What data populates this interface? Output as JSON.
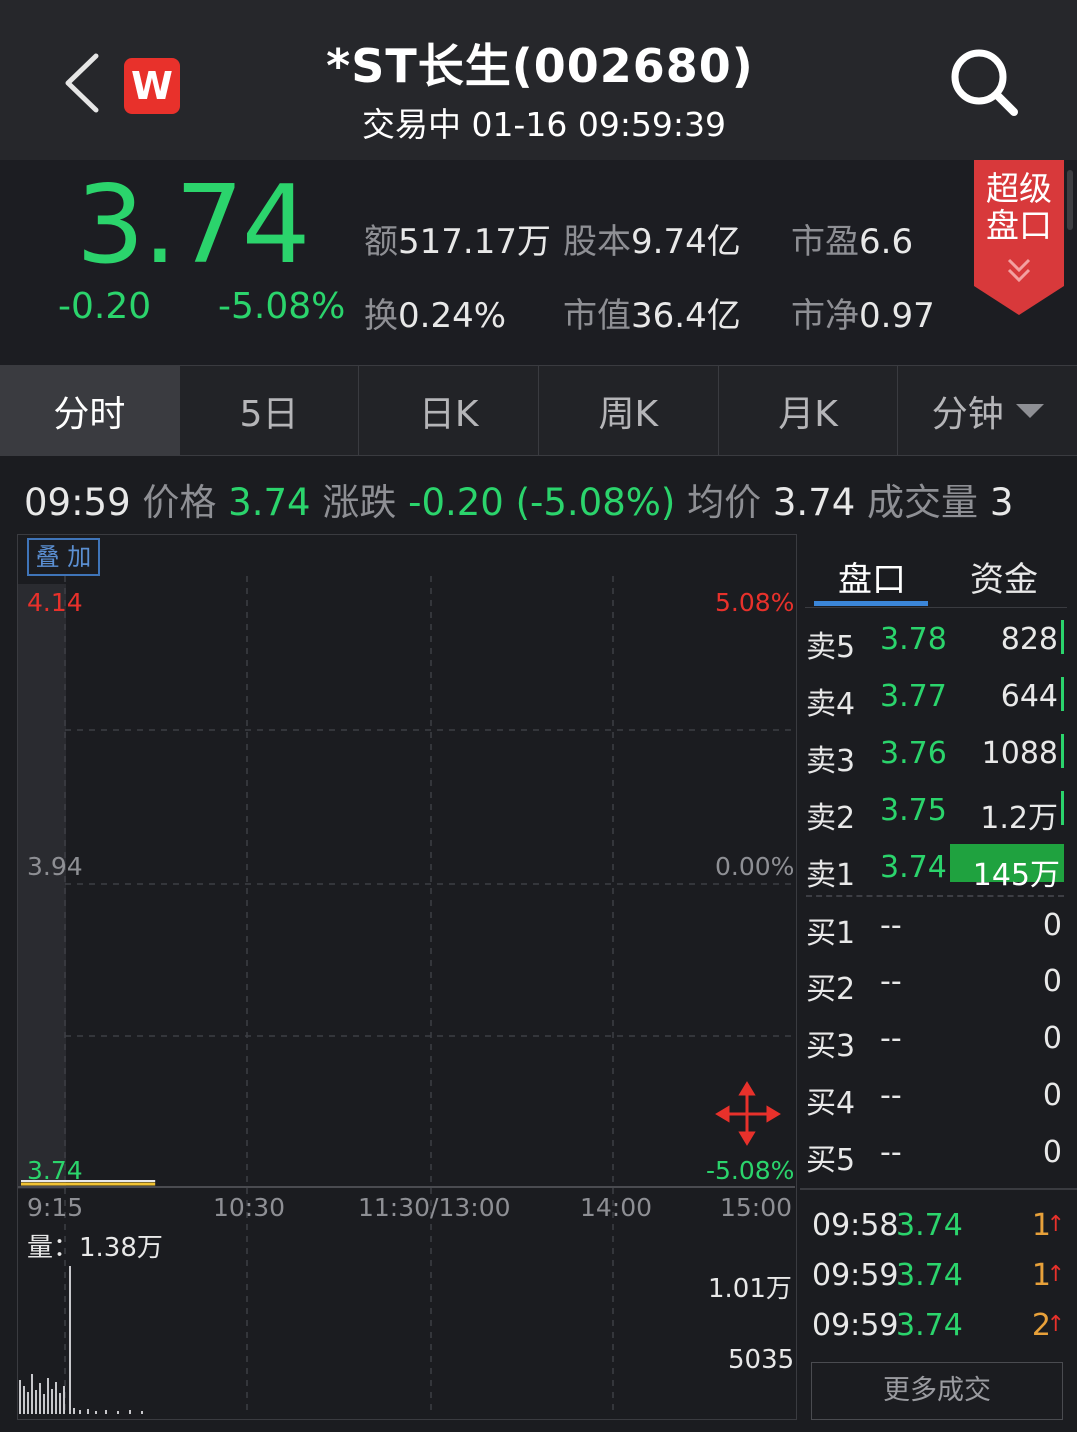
{
  "header": {
    "title": "*ST长生(002680)",
    "subtitle": "交易中 01-16 09:59:39",
    "logo_letter": "W"
  },
  "quote": {
    "price": "3.74",
    "change": "-0.20",
    "change_pct": "-5.08%",
    "stats": [
      {
        "label": "额",
        "value": "517.17万"
      },
      {
        "label": "股本",
        "value": "9.74亿"
      },
      {
        "label": "市盈",
        "value": "6.6"
      },
      {
        "label": "换",
        "value": "0.24%"
      },
      {
        "label": "市值",
        "value": "36.4亿"
      },
      {
        "label": "市净",
        "value": "0.97"
      }
    ],
    "super_label": "超级盘口"
  },
  "tabs": [
    "分时",
    "5日",
    "日K",
    "周K",
    "月K",
    "分钟"
  ],
  "info": {
    "time": "09:59",
    "price_label": "价格",
    "price": "3.74",
    "chg_label": "涨跌",
    "chg": "-0.20 (-5.08%)",
    "avg_label": "均价",
    "avg": "3.74",
    "vol_label": "成交量",
    "vol": "3"
  },
  "chart": {
    "overlay_label": "叠 加",
    "y_top": "4.14",
    "y_mid": "3.94",
    "y_bot": "3.74",
    "pct_top": "5.08%",
    "pct_mid": "0.00%",
    "pct_bot": "-5.08%",
    "x_labels": [
      "9:15",
      "10:30",
      "11:30/13:00",
      "14:00",
      "15:00"
    ],
    "volume_label": "量：1.38万",
    "vol_top": "1.01万",
    "vol_mid": "5035"
  },
  "chart_data": {
    "type": "line",
    "x": [
      "09:15",
      "09:59"
    ],
    "series": [
      {
        "values": [
          3.74,
          3.74
        ]
      }
    ],
    "ylim": [
      3.74,
      4.14
    ],
    "xlabel": "",
    "ylabel": ""
  },
  "orderbook": {
    "tabs": [
      "盘口",
      "资金"
    ],
    "sell": [
      {
        "label": "卖5",
        "price": "3.78",
        "vol": "828"
      },
      {
        "label": "卖4",
        "price": "3.77",
        "vol": "644"
      },
      {
        "label": "卖3",
        "price": "3.76",
        "vol": "1088"
      },
      {
        "label": "卖2",
        "price": "3.75",
        "vol": "1.2万"
      },
      {
        "label": "卖1",
        "price": "3.74",
        "vol": "145万"
      }
    ],
    "buy": [
      {
        "label": "买1",
        "price": "--",
        "vol": "0"
      },
      {
        "label": "买2",
        "price": "--",
        "vol": "0"
      },
      {
        "label": "买3",
        "price": "--",
        "vol": "0"
      },
      {
        "label": "买4",
        "price": "--",
        "vol": "0"
      },
      {
        "label": "买5",
        "price": "--",
        "vol": "0"
      }
    ],
    "trades": [
      {
        "time": "09:58",
        "price": "3.74",
        "qty": "1"
      },
      {
        "time": "09:59",
        "price": "3.74",
        "qty": "1"
      },
      {
        "time": "09:59",
        "price": "3.74",
        "qty": "2"
      }
    ],
    "more_label": "更多成交"
  },
  "colors": {
    "down": "#2bd46c",
    "up": "#e8312b",
    "accent": "#3b86d9"
  }
}
